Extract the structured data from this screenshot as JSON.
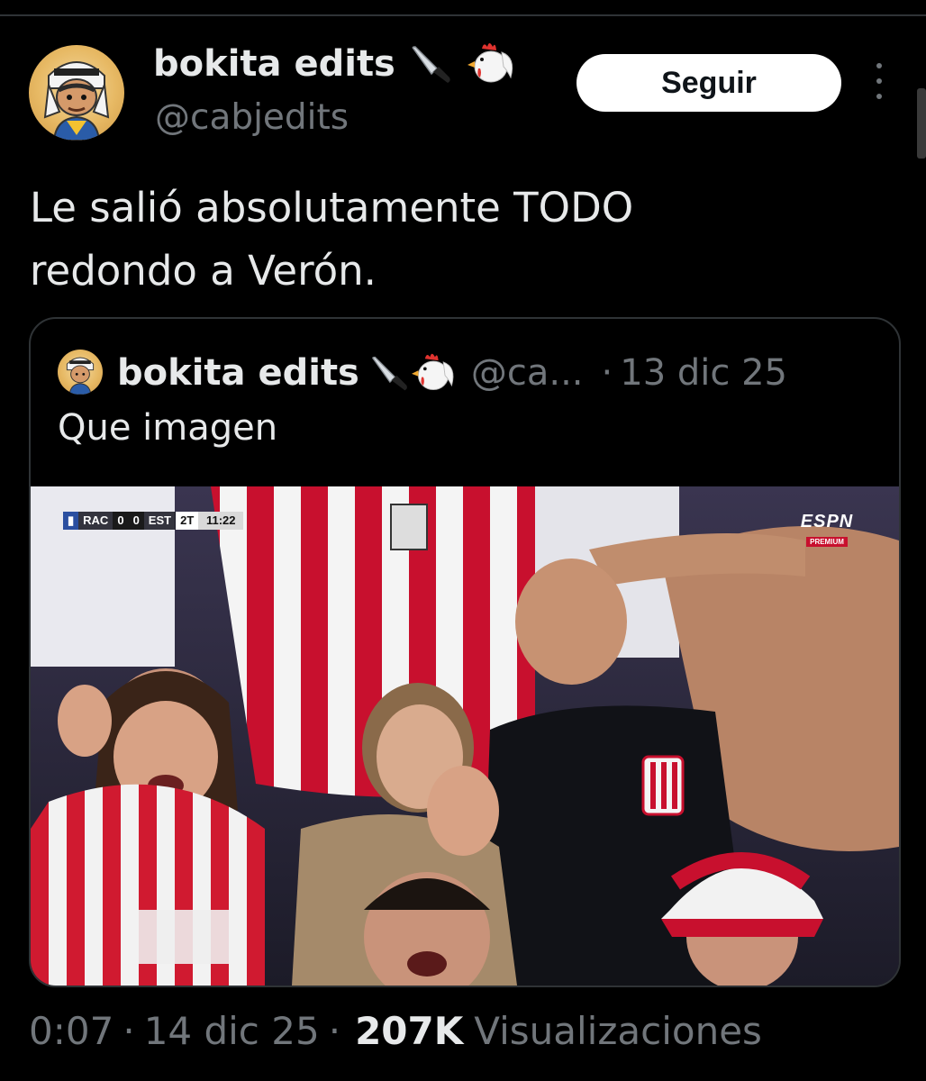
{
  "author": {
    "display_name": "bokita edits",
    "handle": "@cabjedits",
    "emoji_icons": [
      "knife-icon",
      "rooster-icon"
    ]
  },
  "follow_button": {
    "label": "Seguir"
  },
  "tweet": {
    "text": "Le salió absolutamente TODO\nredondo a Verón."
  },
  "quoted_tweet": {
    "display_name": "bokita edits",
    "handle": "@ca...",
    "separator": "·",
    "date": "13 dic 25",
    "text": "Que imagen",
    "media": {
      "scorebug": {
        "home": "RAC",
        "home_score": "0",
        "away_score": "0",
        "away": "EST",
        "period": "2T",
        "clock": "11:22"
      },
      "broadcaster": "ESPN",
      "broadcaster_sub": "PREMIUM"
    }
  },
  "footer": {
    "time": "0:07",
    "separator": "·",
    "date": "14 dic 25",
    "views_count": "207K",
    "views_label": "Visualizaciones"
  },
  "colors": {
    "background": "#000000",
    "text_primary": "#e7e9ea",
    "text_secondary": "#71767b",
    "border": "#2f3336",
    "button_bg": "#ffffff"
  }
}
